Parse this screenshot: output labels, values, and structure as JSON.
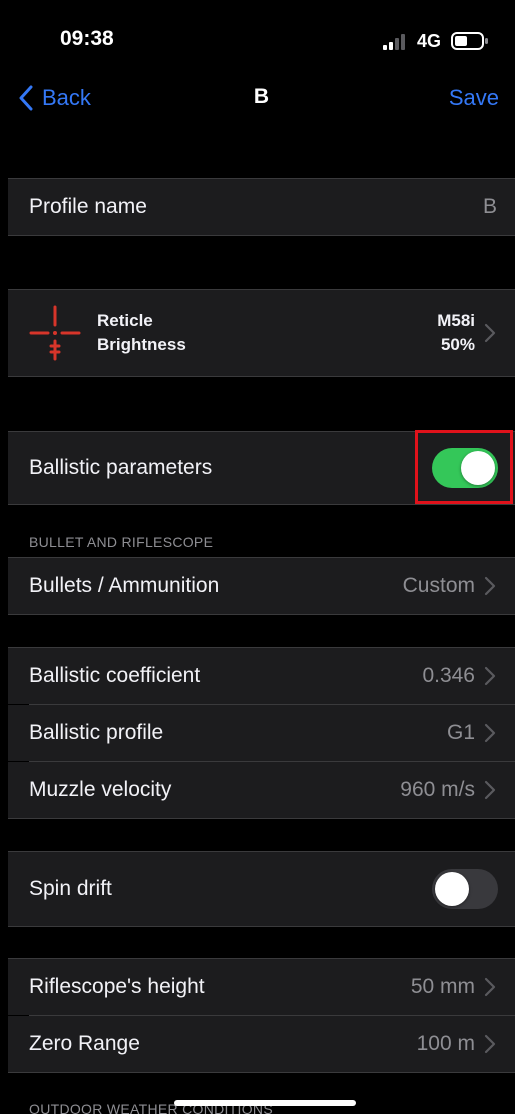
{
  "status": {
    "time": "09:38",
    "network": "4G"
  },
  "nav": {
    "back_label": "Back",
    "title": "B",
    "save_label": "Save"
  },
  "profile": {
    "label": "Profile name",
    "value": "B"
  },
  "reticle": {
    "line1": "Reticle",
    "line2": "Brightness",
    "value1": "M58i",
    "value2": "50%"
  },
  "ballistic": {
    "label": "Ballistic parameters",
    "enabled": true
  },
  "section_bullet": {
    "header": "BULLET AND RIFLESCOPE"
  },
  "bullets": {
    "label": "Bullets / Ammunition",
    "value": "Custom"
  },
  "coefficient": {
    "label": "Ballistic coefficient",
    "value": "0.346"
  },
  "bprofile": {
    "label": "Ballistic profile",
    "value": "G1"
  },
  "velocity": {
    "label": "Muzzle velocity",
    "value": "960 m/s"
  },
  "spin": {
    "label": "Spin drift",
    "enabled": false
  },
  "height": {
    "label": "Riflescope's height",
    "value": "50 mm"
  },
  "zero": {
    "label": "Zero Range",
    "value": "100 m"
  },
  "section_weather": {
    "header": "OUTDOOR WEATHER CONDITIONS"
  },
  "colors": {
    "accent": "#3478f6",
    "toggle_on": "#34c759",
    "highlight": "#e0121b",
    "reticle": "#d7352a"
  }
}
